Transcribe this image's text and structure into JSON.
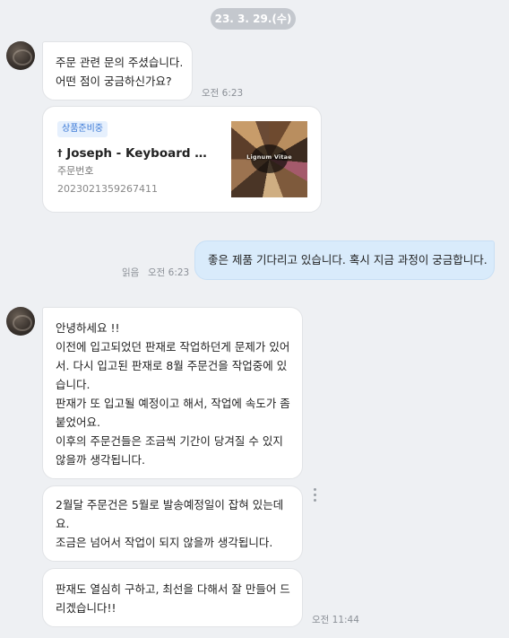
{
  "date_divider": "23. 3. 29.(수)",
  "messages": {
    "greeting": {
      "lines": [
        "주문 관련 문의 주셨습니다.",
        "어떤 점이 궁금하신가요?"
      ],
      "time": "오전 6:23"
    },
    "order_card": {
      "badge": "상품준비중",
      "product_title": "Joseph - Keyboard Pal...",
      "order_label": "주문번호",
      "order_number": "2023021359267411",
      "thumbnail_text": "Lignum Vitae"
    },
    "user_message": {
      "text": "좋은 제품 기다리고 있습니다. 혹시 지금 과정이 궁금합니다.",
      "read_status": "읽음",
      "time": "오전 6:23"
    },
    "reply1": {
      "lines": [
        "안녕하세요 !!",
        "이전에 입고되었던 판재로 작업하던게 문제가 있어",
        "서. 다시 입고된 판재로 8월 주문건을 작업중에 있",
        "습니다.",
        "판재가 또 입고될 예정이고 해서, 작업에 속도가 좀",
        "붙었어요.",
        "이후의 주문건들은 조금씩 기간이 당겨질 수 있지",
        "않을까 생각됩니다."
      ]
    },
    "reply2": {
      "lines": [
        "2월달 주문건은 5월로 발송예정일이 잡혀 있는데",
        "요.",
        "조금은 넘어서 작업이 되지 않을까 생각됩니다."
      ]
    },
    "reply3": {
      "lines": [
        "판재도 열심히 구하고, 최선을 다해서 잘 만들어 드",
        "리겠습니다!!"
      ],
      "time": "오전 11:44"
    }
  },
  "icons": {
    "more": "vertical-ellipsis-icon",
    "title_prefix": "dagger-icon"
  }
}
